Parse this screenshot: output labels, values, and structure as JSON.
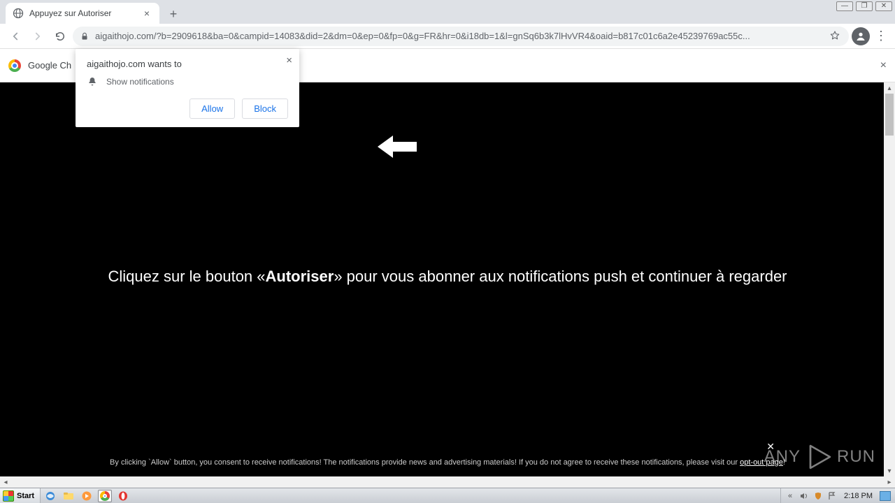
{
  "window": {
    "minimize": "—",
    "maximize": "❐",
    "close": "✕"
  },
  "tab": {
    "title": "Appuyez sur Autoriser",
    "close": "×"
  },
  "toolbar": {
    "url": "aigaithojo.com/?b=2909618&ba=0&campid=14083&did=2&dm=0&ep=0&fp=0&g=FR&hr=0&i18db=1&l=gnSq6b3k7lHvVR4&oaid=b817c01c6a2e45239769ac55c..."
  },
  "infobar": {
    "text": "Google Ch"
  },
  "perm": {
    "title": "aigaithojo.com wants to",
    "row": "Show notifications",
    "allow": "Allow",
    "block": "Block",
    "close": "×"
  },
  "page": {
    "text_pre": "Cliquez sur le bouton «",
    "text_bold": "Autoriser",
    "text_post": "» pour vous abonner aux notifications push et continuer à regarder",
    "disclaimer_pre": "By clicking `Allow` button, you consent to receive notifications! The notifications provide news and advertising materials! If you do not agree to receive these notifications, please visit our ",
    "opt_out": "opt-out page",
    "disclaimer_post": "!",
    "disc_close": "✕"
  },
  "watermark": {
    "left": "ANY",
    "right": "RUN"
  },
  "taskbar": {
    "start": "Start",
    "clock": "2:18 PM"
  }
}
